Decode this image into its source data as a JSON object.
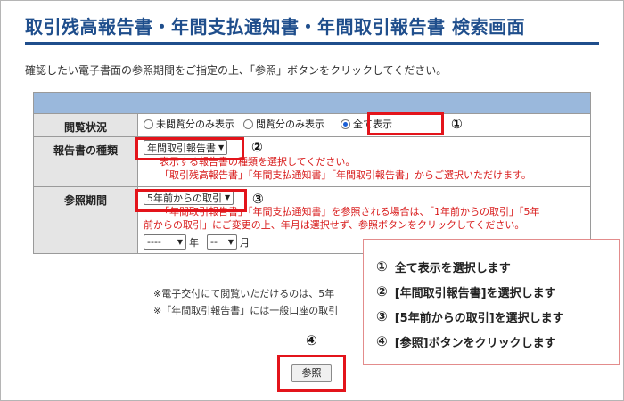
{
  "page": {
    "title": "取引残高報告書・年間支払通知書・年間取引報告書 検索画面",
    "instruction": "確認したい電子書面の参照期間をご指定の上、「参照」ボタンをクリックしてください。"
  },
  "form": {
    "view_status": {
      "label": "閲覧状況",
      "options": [
        "未閲覧分のみ表示",
        "閲覧分のみ表示",
        "全て表示"
      ],
      "selected": "全て表示"
    },
    "report_type": {
      "label": "報告書の種類",
      "selected": "年間取引報告書",
      "hint1": "表示する報告書の種類を選択してください。",
      "hint2": "「取引残高報告書」「年間支払通知書」「年間取引報告書」からご選択いただけます。"
    },
    "period": {
      "label": "参照期間",
      "selected": "5年前からの取引",
      "hint1": "「年間取引報告書」「年間支払通知書」を参照される場合は、「1年前からの取引」「5年",
      "hint2": "前からの取引」にご変更の上、年月は選択せず、参照ボタンをクリックしてください。",
      "year_value": "----",
      "year_unit": "年",
      "month_value": "--",
      "month_unit": "月"
    }
  },
  "notes": [
    "※電子交付にて閲覧いただけるのは、5年",
    "※「年間取引報告書」には一般口座の取引"
  ],
  "callout": {
    "steps": [
      {
        "num": "①",
        "text": "全て表示を選択します"
      },
      {
        "num": "②",
        "text": "[年間取引報告書]を選択します"
      },
      {
        "num": "③",
        "text": "[5年前からの取引]を選択します"
      },
      {
        "num": "④",
        "text": "[参照]ボタンをクリックします"
      }
    ]
  },
  "markers": {
    "m1": "①",
    "m2": "②",
    "m3": "③",
    "m4": "④"
  },
  "button": {
    "ref_label": "参照"
  },
  "colors": {
    "title": "#1f4e8c",
    "band": "#9ab8dc",
    "highlight": "#e3141b",
    "hint": "#d81b1b"
  }
}
